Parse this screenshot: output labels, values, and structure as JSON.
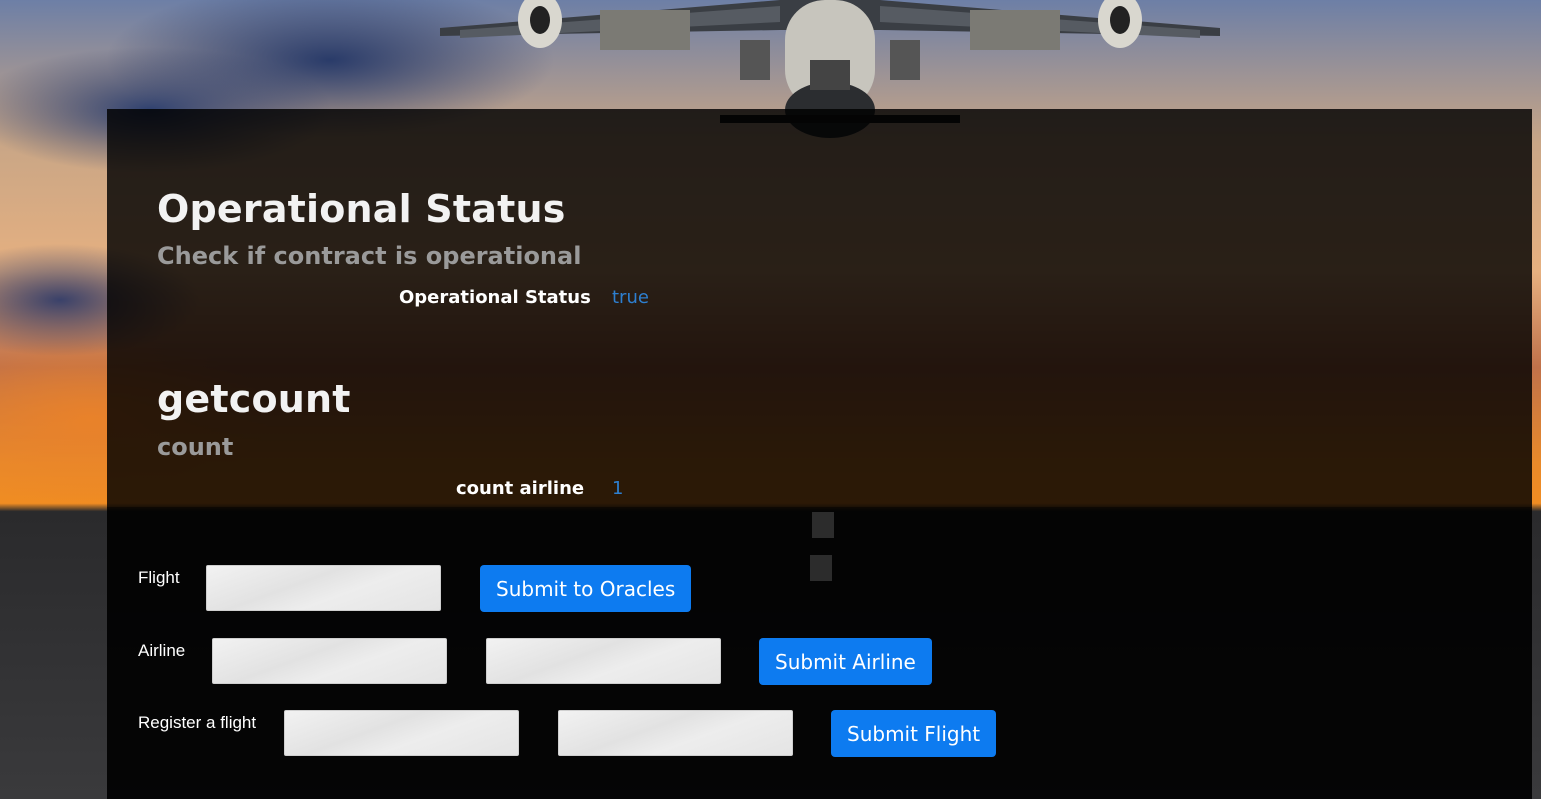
{
  "operational": {
    "title": "Operational Status",
    "subtitle": "Check if contract is operational",
    "label": "Operational Status",
    "value": "true"
  },
  "count": {
    "title": "getcount",
    "subtitle": "count",
    "label": "count airline",
    "value": "1"
  },
  "forms": {
    "flight": {
      "label": "Flight",
      "input_value": "",
      "button": "Submit to Oracles"
    },
    "airline": {
      "label": "Airline",
      "input1_value": "",
      "input2_value": "",
      "button": "Submit Airline"
    },
    "register": {
      "label": "Register a flight",
      "input1_value": "",
      "input2_value": "",
      "button": "Submit Flight"
    }
  },
  "colors": {
    "button": "#0d7bf0",
    "value_text": "#2d7fd0",
    "panel": "rgba(0,0,0,0.82)"
  },
  "icons": {
    "background": "airplane-landing-sunset-image"
  }
}
